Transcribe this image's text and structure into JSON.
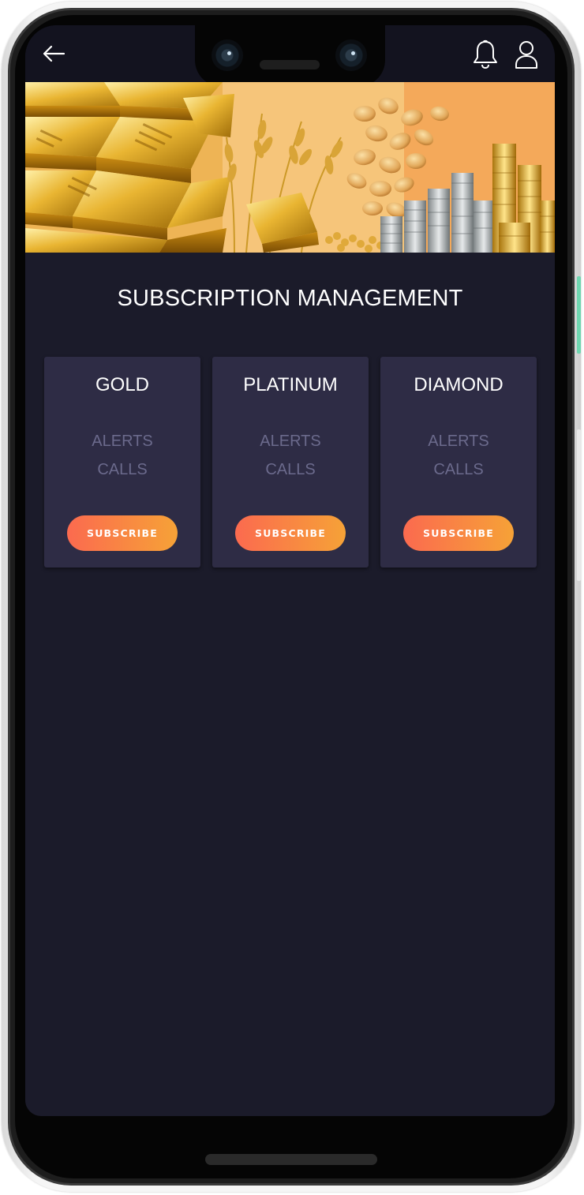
{
  "header": {
    "back_icon": "arrow-left-icon",
    "notification_icon": "bell-icon",
    "profile_icon": "user-icon"
  },
  "banner": {
    "image": "gold bars, wheat, beans and coin stacks"
  },
  "page": {
    "title": "SUBSCRIPTION MANAGEMENT"
  },
  "plans": [
    {
      "name": "GOLD",
      "features": [
        "ALERTS",
        "CALLS"
      ],
      "button": "SUBSCRIBE"
    },
    {
      "name": "PLATINUM",
      "features": [
        "ALERTS",
        "CALLS"
      ],
      "button": "SUBSCRIBE"
    },
    {
      "name": "DIAMOND",
      "features": [
        "ALERTS",
        "CALLS"
      ],
      "button": "SUBSCRIBE"
    }
  ],
  "colors": {
    "background": "#1b1b2a",
    "card": "#2e2c45",
    "feature_text": "#6b6a8c",
    "button_start": "#fb6a4f",
    "button_end": "#f6a237"
  }
}
